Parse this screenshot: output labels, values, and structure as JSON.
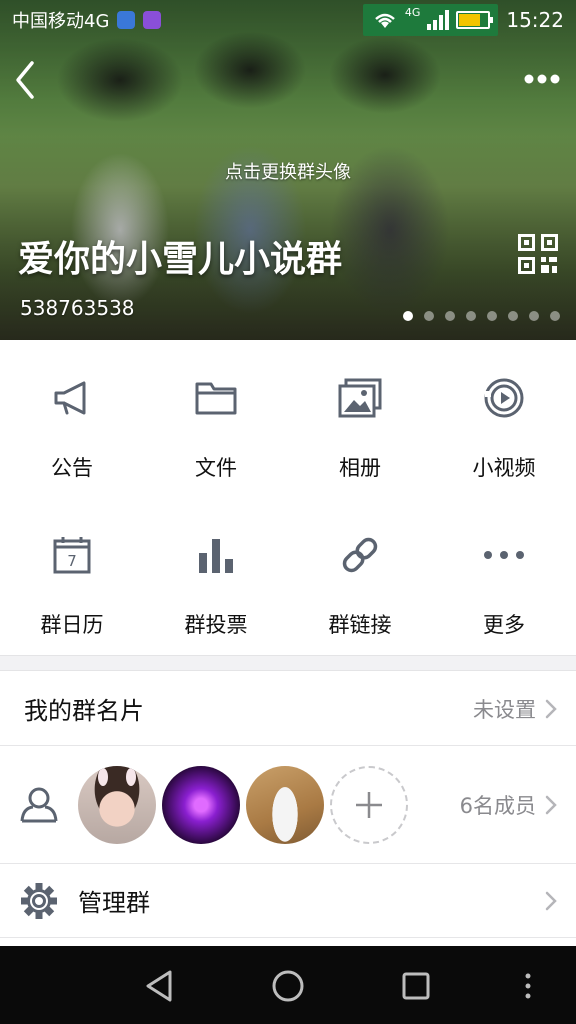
{
  "status_bar": {
    "carrier": "中国移动4G",
    "network_label": "4G",
    "time": "15:22",
    "battery_level": 0.75
  },
  "header": {
    "change_avatar_hint": "点击更换群头像",
    "group_name": "爱你的小雪儿小说群",
    "group_id": "538763538",
    "carousel_pages": 8,
    "carousel_active": 0
  },
  "features": [
    {
      "label": "公告",
      "icon": "megaphone-icon"
    },
    {
      "label": "文件",
      "icon": "folder-icon"
    },
    {
      "label": "相册",
      "icon": "album-icon"
    },
    {
      "label": "小视频",
      "icon": "video-play-icon"
    },
    {
      "label": "群日历",
      "icon": "calendar-icon",
      "icon_text": "7"
    },
    {
      "label": "群投票",
      "icon": "bar-chart-icon"
    },
    {
      "label": "群链接",
      "icon": "link-icon"
    },
    {
      "label": "更多",
      "icon": "more-dots-icon"
    }
  ],
  "my_card": {
    "title": "我的群名片",
    "value": "未设置"
  },
  "members": {
    "count_label": "6名成员"
  },
  "manage": {
    "title": "管理群"
  },
  "colors": {
    "icon_gray": "#5b6370",
    "status_green": "#1e7a3c",
    "divider": "#e6e6e8"
  }
}
